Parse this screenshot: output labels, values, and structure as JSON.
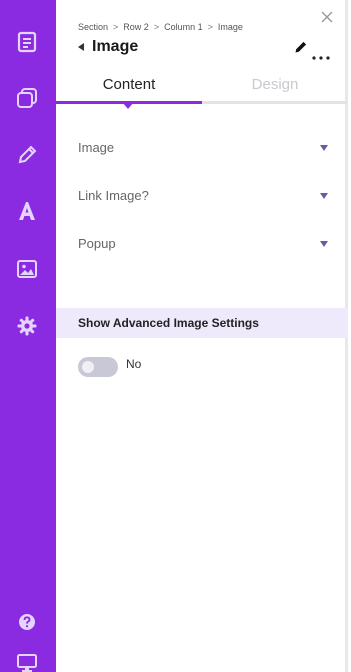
{
  "sidebar": {
    "icons": [
      "page-icon",
      "layers-icon",
      "pencil-icon",
      "font-icon",
      "image-icon",
      "gear-icon",
      "help-icon",
      "desktop-icon"
    ]
  },
  "breadcrumb": [
    "Section",
    "Row 2",
    "Column 1",
    "Image"
  ],
  "breadcrumb_separator": ">",
  "header": {
    "title": "Image"
  },
  "tabs": [
    {
      "label": "Content",
      "active": true
    },
    {
      "label": "Design",
      "active": false
    }
  ],
  "accordions": [
    {
      "label": "Image"
    },
    {
      "label": "Link Image?"
    },
    {
      "label": "Popup"
    }
  ],
  "advanced": {
    "label": "Show Advanced Image Settings",
    "toggle_label": "No",
    "enabled": false
  },
  "colors": {
    "accent": "#8a2be2",
    "band": "#eeeafc"
  }
}
